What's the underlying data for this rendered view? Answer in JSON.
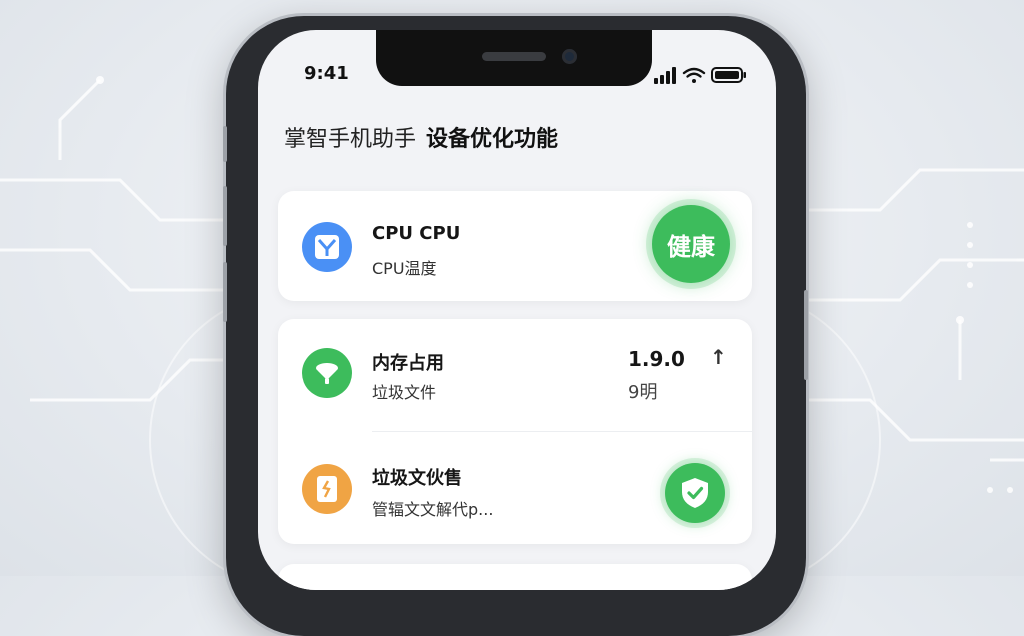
{
  "status_bar": {
    "time": "9:41"
  },
  "header": {
    "app_name": "掌智手机助手",
    "section_title": "设备优化功能"
  },
  "cards": {
    "cpu": {
      "title": "CPU CPU",
      "subtitle": "CPU温度",
      "status": "健康",
      "icon": "grid-app-icon"
    },
    "memory": {
      "title": "内存占用",
      "subtitle": "垃圾文件",
      "value": "1.9.0",
      "value_sub": "9明",
      "trend_icon": "arrow-up-icon",
      "icon": "broom-icon"
    },
    "junk": {
      "title": "垃圾文伙售",
      "subtitle": "管辐文文解代p...",
      "icon": "file-icon",
      "status_icon": "shield-check-icon"
    }
  },
  "colors": {
    "accent_green": "#3dbc5c",
    "blue_icon": "#4a90f5",
    "green_icon": "#3dbc5c",
    "orange_icon": "#f0a444"
  }
}
